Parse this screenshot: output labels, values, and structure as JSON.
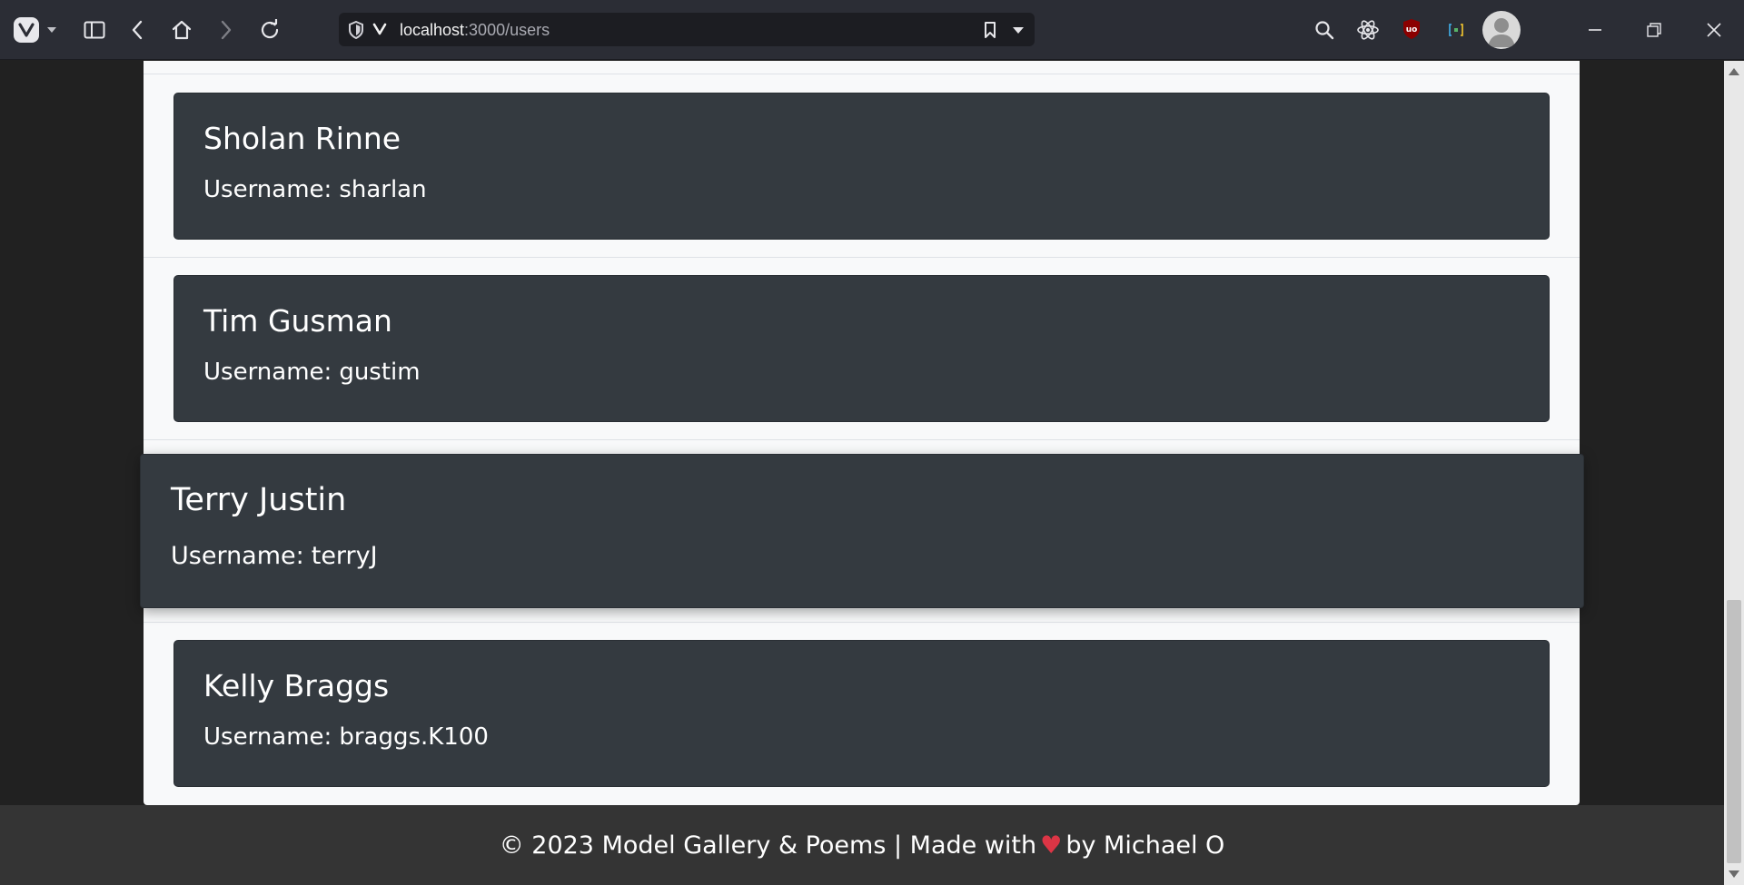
{
  "browser": {
    "url_host": "localhost",
    "url_path": ":3000/users"
  },
  "users": [
    {
      "name": "Sholan Rinne",
      "username_label": "Username:",
      "username": "sharlan"
    },
    {
      "name": "Tim Gusman",
      "username_label": "Username:",
      "username": "gustim"
    },
    {
      "name": "Terry Justin",
      "username_label": "Username:",
      "username": "terryJ"
    },
    {
      "name": "Kelly Braggs",
      "username_label": "Username:",
      "username": "braggs.K100"
    }
  ],
  "footer": {
    "before_heart": "© 2023 Model Gallery & Poems | Made with",
    "heart": "♥",
    "after_heart": "by Michael O"
  },
  "colors": {
    "card_bg": "#343a40",
    "panel_bg": "#f8f9fa",
    "footer_bg": "#343434",
    "heart": "#dc3545"
  },
  "icons": [
    "vivaldi-logo",
    "panel-toggle-icon",
    "back-icon",
    "home-icon",
    "forward-icon",
    "reload-icon",
    "site-info-icon",
    "bookmark-icon",
    "dropdown-icon",
    "search-icon",
    "react-devtools-icon",
    "ublock-icon",
    "extension-icon",
    "minimize-icon",
    "restore-icon",
    "close-icon"
  ]
}
